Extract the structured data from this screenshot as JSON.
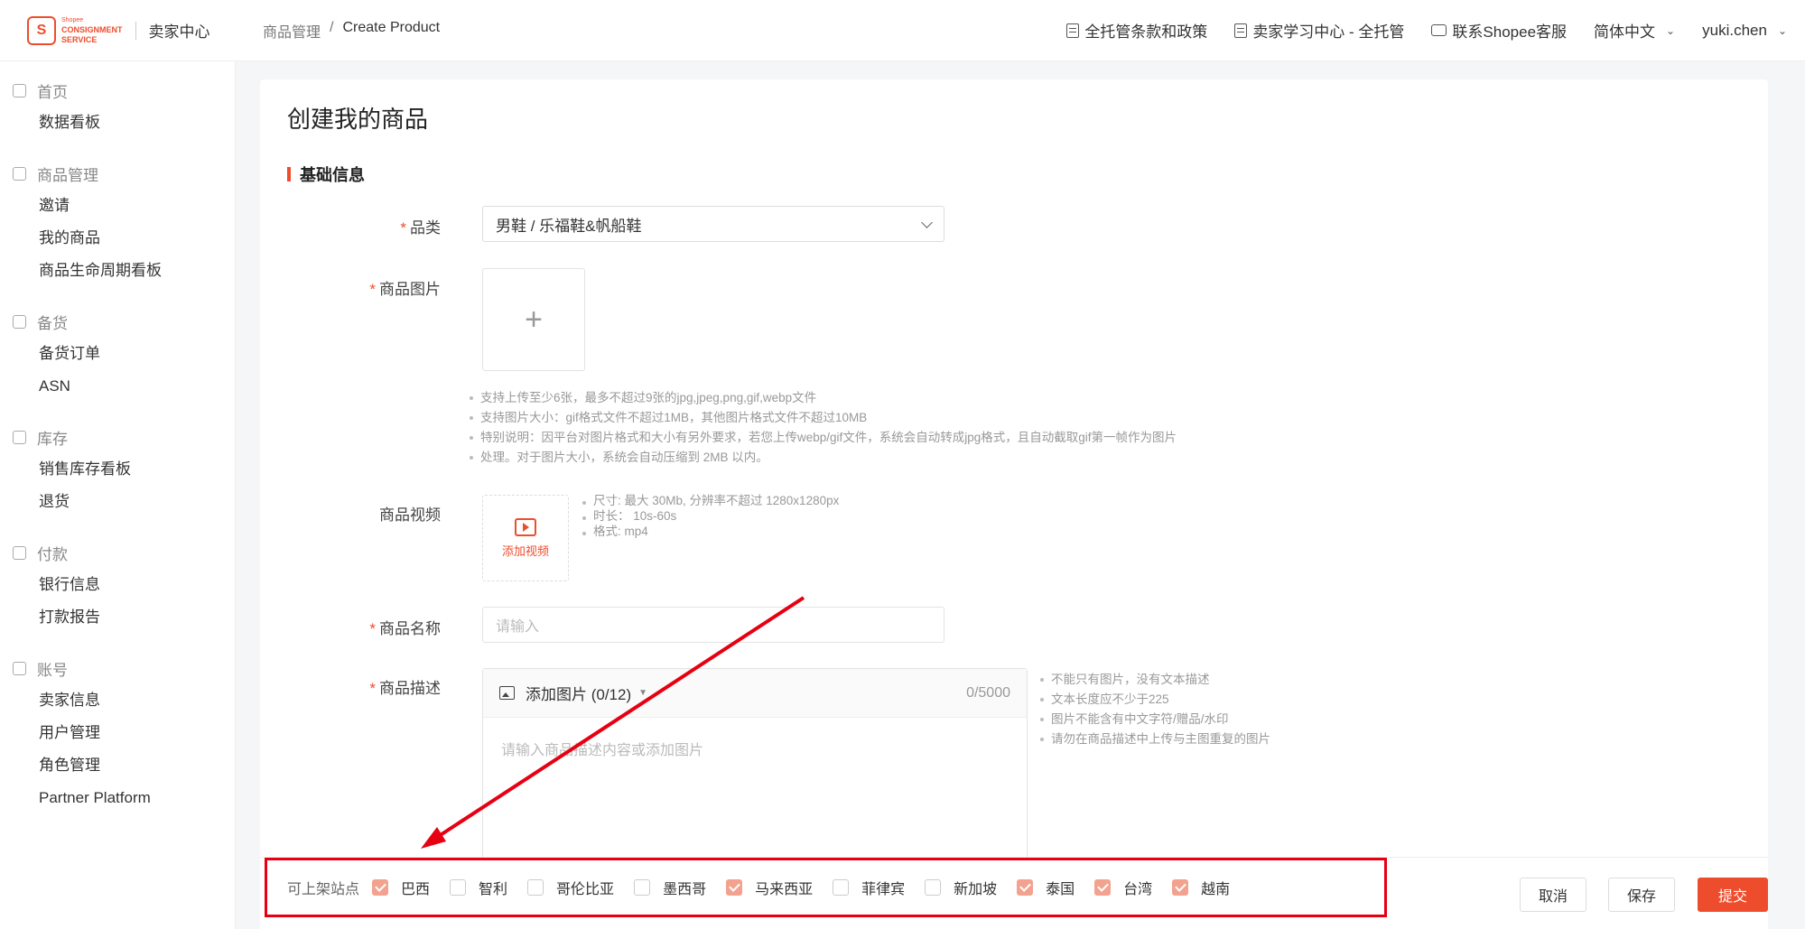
{
  "header": {
    "logo_brand": "Shopee",
    "logo_line1": "CONSIGNMENT",
    "logo_line2": "SERVICE",
    "app_title": "卖家中心",
    "breadcrumb": [
      "商品管理",
      "/",
      "Create Product"
    ],
    "links": [
      {
        "icon": "document-icon",
        "label": "全托管条款和政策"
      },
      {
        "icon": "book-icon",
        "label": "卖家学习中心 - 全托管"
      },
      {
        "icon": "chat-icon",
        "label": "联系Shopee客服"
      }
    ],
    "language": "简体中文",
    "user": "yuki.chen"
  },
  "sidebar": {
    "groups": [
      {
        "title": "首页",
        "icon": "home-icon",
        "items": [
          "数据看板"
        ]
      },
      {
        "title": "商品管理",
        "icon": "product-icon",
        "items": [
          "邀请",
          "我的商品",
          "商品生命周期看板"
        ]
      },
      {
        "title": "备货",
        "icon": "clipboard-icon",
        "items": [
          "备货订单",
          "ASN"
        ]
      },
      {
        "title": "库存",
        "icon": "warehouse-icon",
        "items": [
          "销售库存看板",
          "退货"
        ]
      },
      {
        "title": "付款",
        "icon": "wallet-icon",
        "items": [
          "银行信息",
          "打款报告"
        ]
      },
      {
        "title": "账号",
        "icon": "user-icon",
        "items": [
          "卖家信息",
          "用户管理",
          "角色管理",
          "Partner Platform"
        ]
      }
    ]
  },
  "main": {
    "page_title": "创建我的商品",
    "section_title": "基础信息",
    "category": {
      "label": "品类",
      "value": "男鞋 / 乐福鞋&帆船鞋"
    },
    "images": {
      "label": "商品图片",
      "hints": [
        "支持上传至少6张，最多不超过9张的jpg,jpeg,png,gif,webp文件",
        "支持图片大小：gif格式文件不超过1MB，其他图片格式文件不超过10MB",
        "特别说明：因平台对图片格式和大小有另外要求，若您上传webp/gif文件，系统会自动转成jpg格式，且自动截取gif第一帧作为图片",
        "处理。对于图片大小，系统会自动压缩到 2MB 以内。"
      ]
    },
    "video": {
      "label": "商品视频",
      "button": "添加视频",
      "hints": [
        "尺寸: 最大 30Mb, 分辨率不超过 1280x1280px",
        "时长： 10s-60s",
        "格式: mp4"
      ]
    },
    "name": {
      "label": "商品名称",
      "placeholder": "请输入"
    },
    "description": {
      "label": "商品描述",
      "add_image": "添加图片 (0/12)",
      "counter": "0/5000",
      "placeholder": "请输入商品描述内容或添加图片",
      "hints": [
        "不能只有图片，没有文本描述",
        "文本长度应不少于225",
        "图片不能含有中文字符/赠品/水印",
        "请勿在商品描述中上传与主图重复的图片"
      ]
    }
  },
  "footer": {
    "sites_label": "可上架站点",
    "sites": [
      {
        "name": "巴西",
        "checked": true
      },
      {
        "name": "智利",
        "checked": false
      },
      {
        "name": "哥伦比亚",
        "checked": false
      },
      {
        "name": "墨西哥",
        "checked": false
      },
      {
        "name": "马来西亚",
        "checked": true
      },
      {
        "name": "菲律宾",
        "checked": false
      },
      {
        "name": "新加坡",
        "checked": false
      },
      {
        "name": "泰国",
        "checked": true
      },
      {
        "name": "台湾",
        "checked": true
      },
      {
        "name": "越南",
        "checked": true
      }
    ],
    "cancel": "取消",
    "save": "保存",
    "submit": "提交"
  },
  "colors": {
    "accent": "#ee4d2d",
    "annotation": "#e60012",
    "checked": "#f2a28f"
  }
}
